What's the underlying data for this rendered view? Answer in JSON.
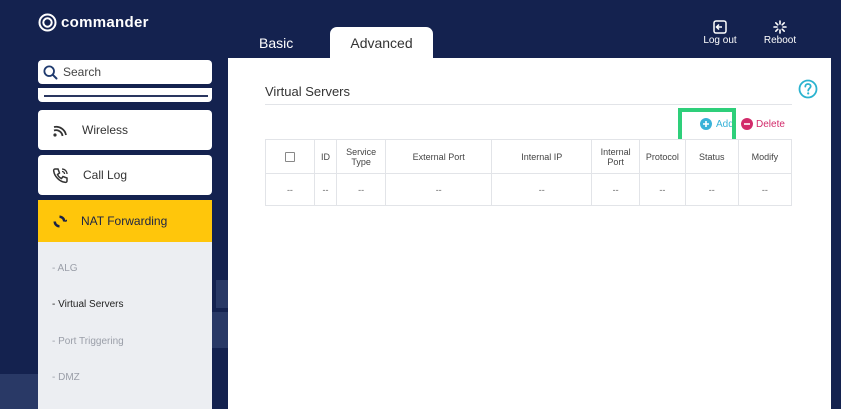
{
  "brand": {
    "name": "commander"
  },
  "tabs": [
    {
      "label": "Basic",
      "active": false
    },
    {
      "label": "Advanced",
      "active": true
    }
  ],
  "top_actions": {
    "logout_label": "Log out",
    "reboot_label": "Reboot"
  },
  "sidebar": {
    "search_placeholder": "Search",
    "items": [
      {
        "label": "Wireless",
        "icon": "wifi-icon"
      },
      {
        "label": "Call Log",
        "icon": "phone-icon"
      },
      {
        "label": "NAT Forwarding",
        "icon": "nat-forwarding-icon",
        "active": true
      }
    ],
    "sub_items": [
      {
        "label": "- ALG"
      },
      {
        "label": "- Virtual Servers",
        "active": true
      },
      {
        "label": "- Port Triggering"
      },
      {
        "label": "- DMZ"
      }
    ]
  },
  "main": {
    "title": "Virtual Servers",
    "actions": {
      "add_label": "Add",
      "delete_label": "Delete"
    },
    "table": {
      "columns": [
        "",
        "ID",
        "Service Type",
        "External Port",
        "Internal IP",
        "Internal Port",
        "Protocol",
        "Status",
        "Modify"
      ],
      "rows": [
        [
          "",
          "--",
          "--",
          "--",
          "--",
          "--",
          "--",
          "--",
          "--"
        ]
      ]
    }
  },
  "colors": {
    "navy": "#14224f",
    "accent_yellow": "#ffc60b",
    "add_blue": "#38b2d8",
    "delete_pink": "#d22a6a",
    "highlight_green": "#2ecf7a",
    "help_teal": "#2bb3cf"
  }
}
